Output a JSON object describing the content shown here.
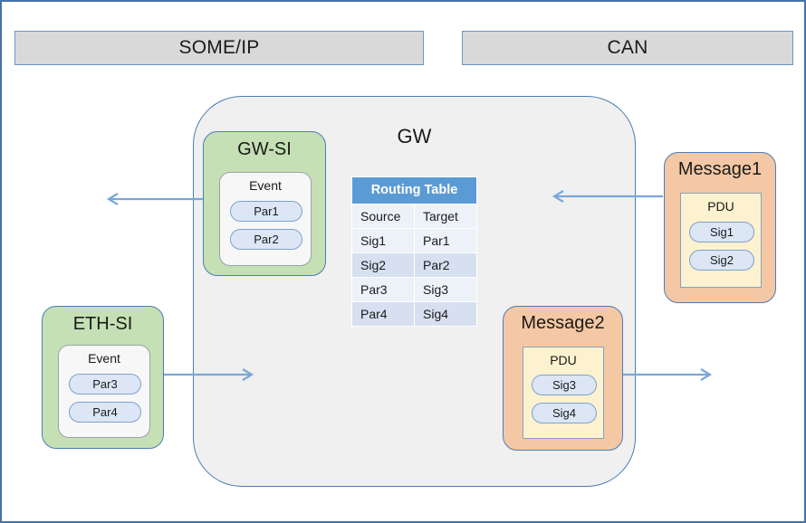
{
  "diagram": {
    "title": "GW",
    "banners": [
      {
        "id": "someip",
        "label": "SOME/IP"
      },
      {
        "id": "can",
        "label": "CAN"
      }
    ],
    "gw": {
      "label": "GW",
      "routing_table": {
        "title": "Routing Table",
        "columns": [
          "Source",
          "Target"
        ],
        "rows": [
          {
            "source": "Sig1",
            "target": "Par1"
          },
          {
            "source": "Sig2",
            "target": "Par2"
          },
          {
            "source": "Par3",
            "target": "Sig3"
          },
          {
            "source": "Par4",
            "target": "Sig4"
          }
        ]
      }
    },
    "nodes": [
      {
        "id": "gw-si",
        "label": "GW-SI",
        "inner_label": "Event",
        "items": [
          "Par1",
          "Par2"
        ]
      },
      {
        "id": "eth-si",
        "label": "ETH-SI",
        "inner_label": "Event",
        "items": [
          "Par3",
          "Par4"
        ]
      },
      {
        "id": "message1",
        "label": "Message1",
        "inner_label": "PDU",
        "items": [
          "Sig1",
          "Sig2"
        ]
      },
      {
        "id": "message2",
        "label": "Message2",
        "inner_label": "PDU",
        "items": [
          "Sig3",
          "Sig4"
        ]
      }
    ],
    "arrows": [
      {
        "id": "gwsi-out",
        "direction": "left",
        "from": "gw-si",
        "to": "someip-bus"
      },
      {
        "id": "can-in",
        "direction": "left",
        "from": "message1",
        "to": "gw"
      },
      {
        "id": "ethsi-in",
        "direction": "right",
        "from": "eth-si",
        "to": "gw"
      },
      {
        "id": "message2-out",
        "direction": "right",
        "from": "message2",
        "to": "can-bus"
      }
    ],
    "colors": {
      "banner_fill": "#d9d9d9",
      "border_blue": "#4a7db5",
      "outer_border": "#4472a8",
      "gw_fill": "#f0f0f0",
      "green_fill": "#c5e0b4",
      "orange_fill": "#f4c8a4",
      "pdu_fill": "#fdf2cf",
      "pill_fill": "#dce6f5",
      "table_header": "#5b9bd5",
      "table_row_light": "#edf1f8",
      "table_row_dark": "#d6e0f0",
      "arrow": "#7ba7d7"
    }
  }
}
